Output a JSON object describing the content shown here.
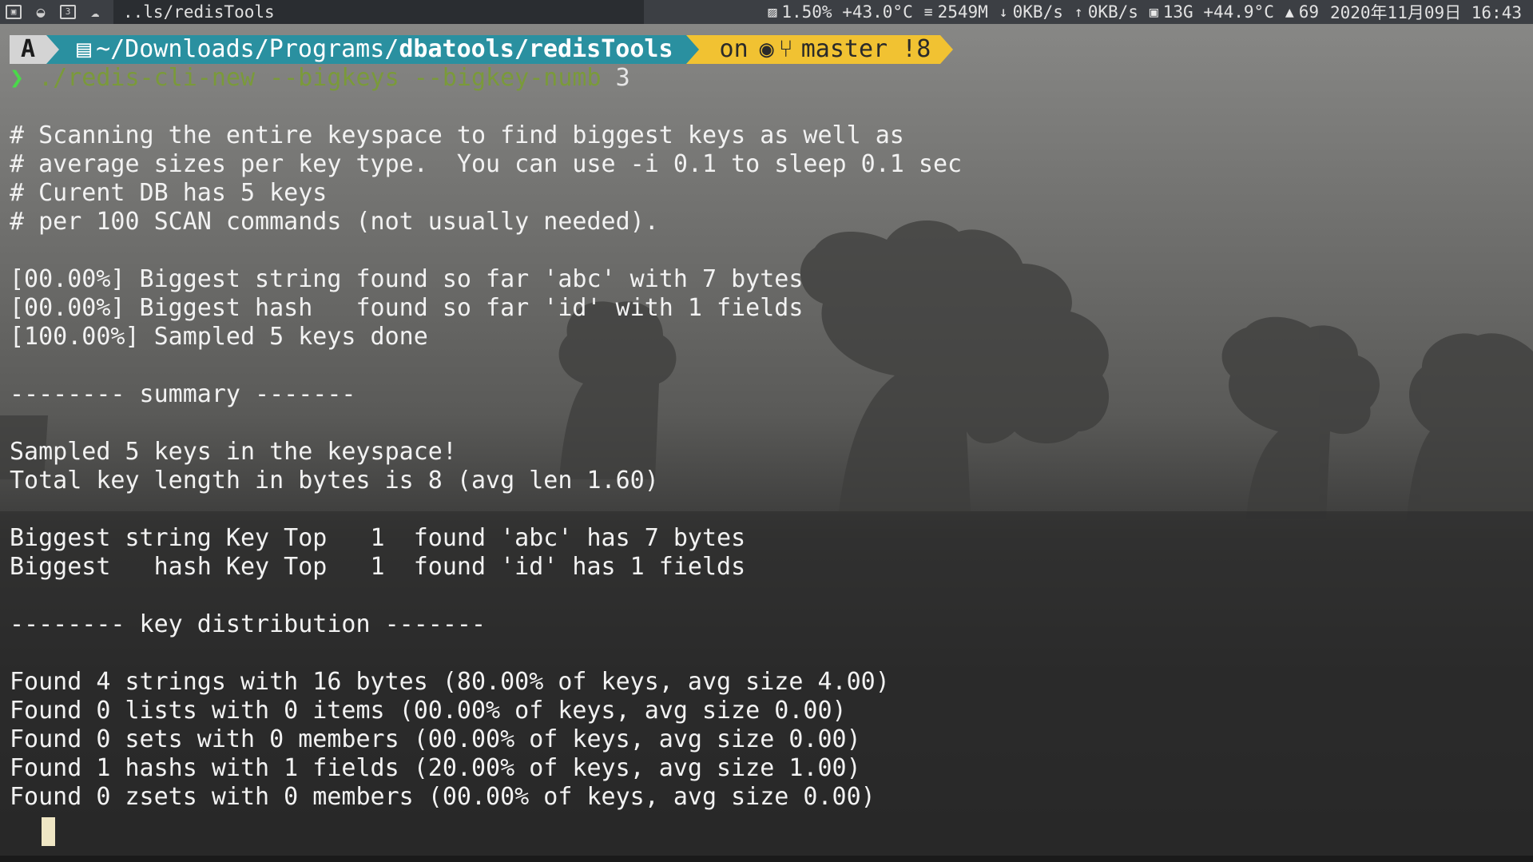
{
  "topbar": {
    "workspace_icons": [
      "terminal-icon",
      "fruit-icon",
      "workspace-3-icon",
      "cloud-icon"
    ],
    "workspace_3_label": "3",
    "window_title": "..ls/redisTools",
    "stats": {
      "cpu": "1.50% +43.0°C",
      "memory": "2549M",
      "download": "0KB/s",
      "upload": "0KB/s",
      "disk": "13G +44.9°C",
      "notifications": "69",
      "datetime": "2020年11月09日 16:43"
    }
  },
  "prompt": {
    "os_glyph": "A",
    "path_prefix": "~/Downloads/Programs/",
    "path_bold": "dbatools/redisTools",
    "git_on": "on",
    "git_branch": "master !8"
  },
  "command": {
    "chevron": "❯",
    "program_and_flags": "./redis-cli-new --bigkeys --bigkey-numb",
    "argument": "3"
  },
  "output_lines": [
    "",
    "# Scanning the entire keyspace to find biggest keys as well as",
    "# average sizes per key type.  You can use -i 0.1 to sleep 0.1 sec",
    "# Curent DB has 5 keys",
    "# per 100 SCAN commands (not usually needed).",
    "",
    "[00.00%] Biggest string found so far 'abc' with 7 bytes",
    "[00.00%] Biggest hash   found so far 'id' with 1 fields",
    "[100.00%] Sampled 5 keys done",
    "",
    "-------- summary -------",
    "",
    "Sampled 5 keys in the keyspace!",
    "Total key length in bytes is 8 (avg len 1.60)",
    "",
    "Biggest string Key Top   1  found 'abc' has 7 bytes",
    "Biggest   hash Key Top   1  found 'id' has 1 fields",
    "",
    "-------- key distribution -------",
    "",
    "Found 4 strings with 16 bytes (80.00% of keys, avg size 4.00)",
    "Found 0 lists with 0 items (00.00% of keys, avg size 0.00)",
    "Found 0 sets with 0 members (00.00% of keys, avg size 0.00)",
    "Found 1 hashs with 1 fields (20.00% of keys, avg size 1.00)",
    "Found 0 zsets with 0 members (00.00% of keys, avg size 0.00)"
  ],
  "colors": {
    "prompt_os_bg": "#d4d4d4",
    "prompt_path_bg": "#2a90a0",
    "prompt_git_bg": "#f1c232",
    "command_green": "#7a9a3a",
    "chevron_green": "#4ad94a",
    "cursor": "#efe6c4"
  }
}
